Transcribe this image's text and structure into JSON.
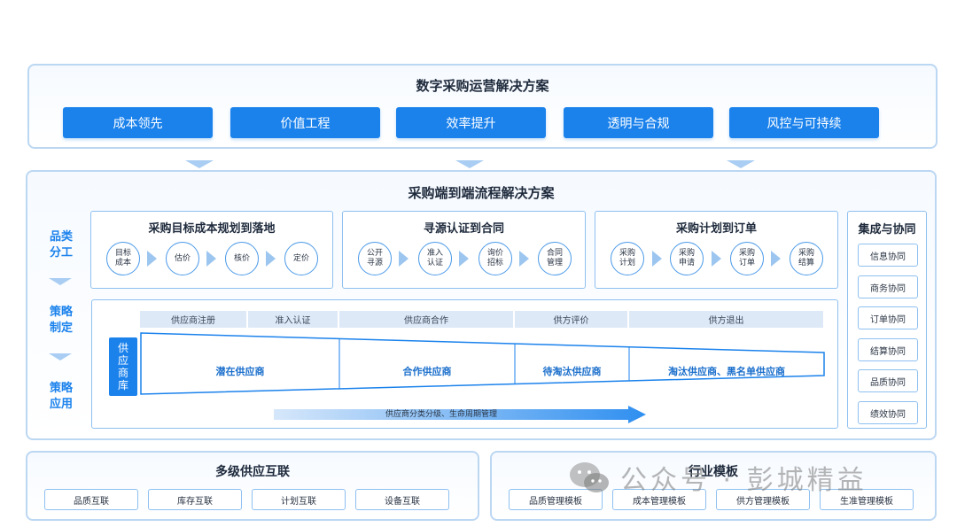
{
  "top": {
    "title": "数字采购运营解决方案",
    "pills": [
      "成本领先",
      "价值工程",
      "效率提升",
      "透明与合规",
      "风控与可持续"
    ]
  },
  "middle": {
    "title": "采购端到端流程解决方案",
    "side_labels": [
      "品类\n分工",
      "策略\n制定",
      "策略\n应用"
    ],
    "processes": [
      {
        "title": "采购目标成本规划到落地",
        "steps": [
          "目标\n成本",
          "估价",
          "核价",
          "定价"
        ]
      },
      {
        "title": "寻源认证到合同",
        "steps": [
          "公开\n寻源",
          "准入\n认证",
          "询价\n招标",
          "合同\n管理"
        ]
      },
      {
        "title": "采购计划到订单",
        "steps": [
          "采购\n计划",
          "采购\n申请",
          "采购\n订单",
          "采购\n结算"
        ]
      }
    ],
    "integration": {
      "title": "集成与协同",
      "items": [
        "信息协同",
        "商务协同",
        "订单协同",
        "结算协同",
        "品质协同",
        "绩效协同"
      ]
    },
    "supplier_library": {
      "label": "供\n应\n商\n库",
      "stages": [
        "供应商注册",
        "准入认证",
        "供应商合作",
        "供方评价",
        "供方退出"
      ],
      "segments": [
        "潜在供应商",
        "合作供应商",
        "待淘汰供应商",
        "淘汰供应商、黑名单供应商"
      ],
      "lifecycle": "供应商分类分级、生命周期管理"
    }
  },
  "bottom": {
    "multi": {
      "title": "多级供应互联",
      "items": [
        "品质互联",
        "库存互联",
        "计划互联",
        "设备互联"
      ]
    },
    "templates": {
      "title": "行业模板",
      "items": [
        "品质管理模板",
        "成本管理模板",
        "供方管理模板",
        "生准管理模板"
      ]
    }
  },
  "watermark": "公众号 · 彭城精益",
  "colors": {
    "accent": "#1b82ec",
    "border": "#8ec0f0",
    "light": "#dde9f7"
  }
}
